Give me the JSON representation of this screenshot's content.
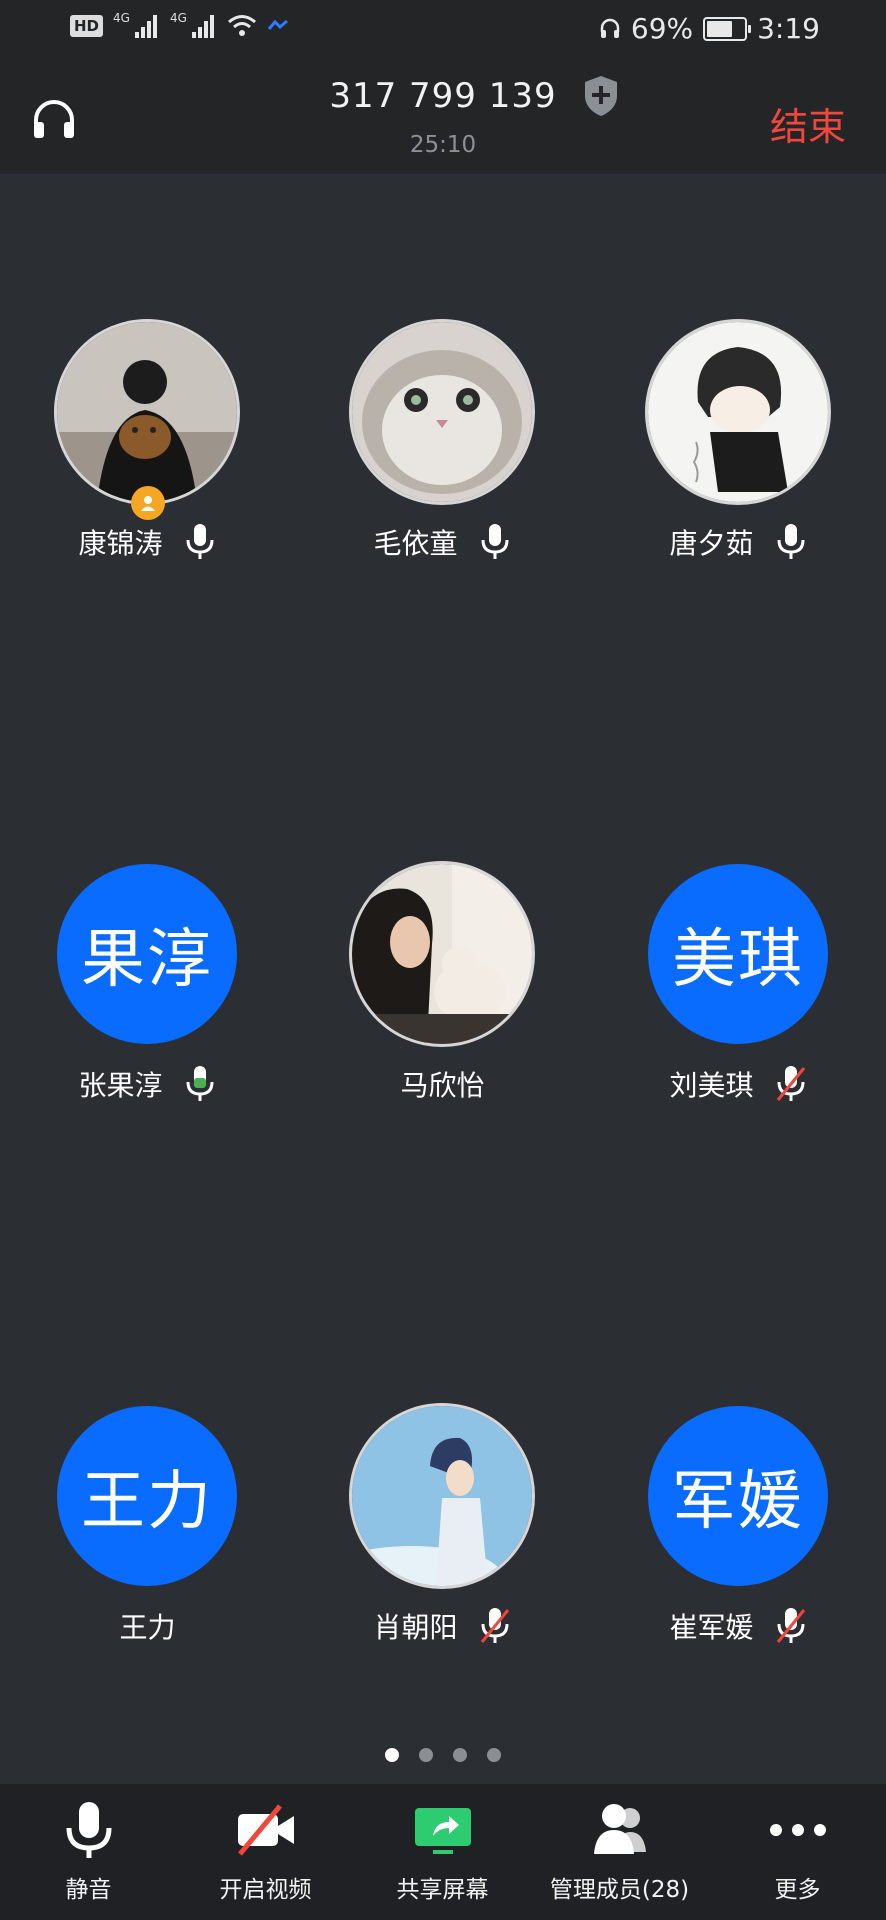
{
  "status_bar": {
    "hd_badge": "HD",
    "network_1": "4G",
    "network_2": "4G",
    "battery_percent": "69%",
    "battery_level": 0.69,
    "time": "3:19"
  },
  "header": {
    "meeting_id": "317 799 139",
    "duration": "25:10",
    "end_label": "结束"
  },
  "participants": [
    {
      "name": "康锦涛",
      "avatar_type": "photo",
      "mic": "on",
      "host": true
    },
    {
      "name": "毛依童",
      "avatar_type": "photo",
      "mic": "on",
      "host": false
    },
    {
      "name": "唐夕茹",
      "avatar_type": "photo",
      "mic": "on",
      "host": false
    },
    {
      "name": "张果淳",
      "avatar_type": "initials",
      "initials": "果淳",
      "mic": "speaking",
      "host": false
    },
    {
      "name": "马欣怡",
      "avatar_type": "photo",
      "mic": "none",
      "host": false
    },
    {
      "name": "刘美琪",
      "avatar_type": "initials",
      "initials": "美琪",
      "mic": "muted",
      "host": false
    },
    {
      "name": "王力",
      "avatar_type": "initials",
      "initials": "王力",
      "mic": "none",
      "host": false
    },
    {
      "name": "肖朝阳",
      "avatar_type": "photo",
      "mic": "muted",
      "host": false
    },
    {
      "name": "崔军媛",
      "avatar_type": "initials",
      "initials": "军媛",
      "mic": "muted",
      "host": false
    }
  ],
  "pagination": {
    "pages": 4,
    "current": 1
  },
  "toolbar": {
    "mute": "静音",
    "video": "开启视频",
    "share": "共享屏幕",
    "members": "管理成员(28)",
    "more": "更多"
  },
  "colors": {
    "background": "#2b2e33",
    "bar": "#232527",
    "accent_blue": "#0a6cff",
    "end_red": "#f0463c",
    "host_badge": "#f5a623",
    "speaking_green": "#4caf50",
    "share_green": "#2ecc71"
  },
  "icons": [
    "headset-icon",
    "shield-plus-icon",
    "microphone-icon",
    "microphone-muted-icon",
    "video-off-icon",
    "share-screen-icon",
    "members-icon",
    "more-dots-icon",
    "host-badge-icon"
  ]
}
